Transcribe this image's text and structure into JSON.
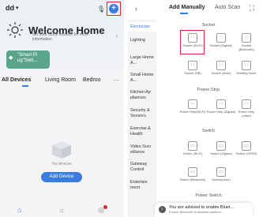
{
  "left": {
    "home_name": "dd",
    "welcome_title": "Welcome Home",
    "welcome_subtitle": "Set your home location for more information",
    "scene_label": "\"Smart Pl ug\"Swit...",
    "tabs": [
      "All Devices",
      "Living Room",
      "Bedroo"
    ],
    "no_devices": "No devices",
    "add_device": "Add Device",
    "colors": {
      "accent": "#3a7de0",
      "highlight": "#e0292e",
      "scene": "#5ba68a"
    }
  },
  "right": {
    "tabs": [
      "Add Manually",
      "Auto Scan"
    ],
    "categories": [
      "Electrician",
      "Lighting",
      "Large Home A...",
      "Small Home A...",
      "Kitchen Ap pliances",
      "Security & Sensors",
      "Exercise & Health",
      "Video Surv eillance",
      "Gateway Control",
      "Entertain ment"
    ],
    "sections": [
      "Socket",
      "Power Strip",
      "Switch",
      "Power Switch"
    ],
    "devices": [
      {
        "label": "Socket (Wi-Fi)"
      },
      {
        "label": "Socket (Zigbee)"
      },
      {
        "label": "Socket (Bluetooth)"
      },
      {
        "label": "Socket (NB)"
      },
      {
        "label": "Socket (other)"
      },
      {
        "label": "Existing Devic"
      },
      {
        "label": "Power Strip(Wi-Fi)"
      },
      {
        "label": "Power Strip (Zigbee)"
      },
      {
        "label": "Power Strip (other)"
      },
      {
        "label": "Switch (Wi-Fi)"
      },
      {
        "label": "Switch (Zigbee)"
      },
      {
        "label": "Switch (GPRS)"
      },
      {
        "label": "Switch (Bluetooth)"
      },
      {
        "label": "Switch(other)"
      }
    ],
    "toast_title": "You are advised to enable Bluet...",
    "toast_sub": "Enable Bluetooth to facilitate addition..."
  }
}
